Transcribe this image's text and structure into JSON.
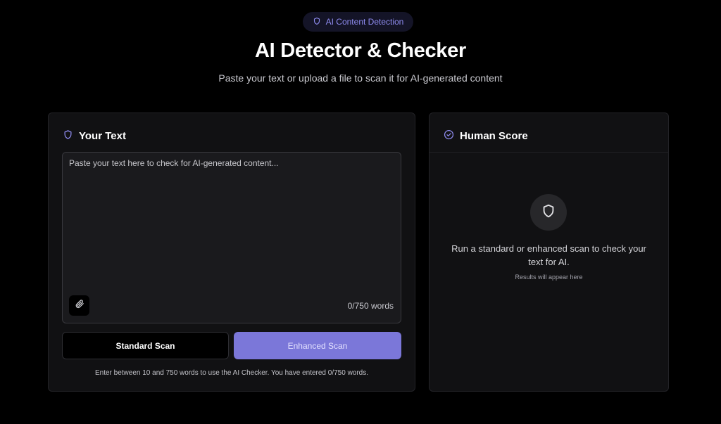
{
  "header": {
    "badge_label": "AI Content Detection",
    "badge_icon": "shield-icon",
    "title": "AI Detector & Checker",
    "subtitle": "Paste your text or upload a file to scan it for AI-generated content"
  },
  "input_panel": {
    "heading": "Your Text",
    "heading_icon": "shield-icon",
    "textarea": {
      "value": "",
      "placeholder": "Paste your text here to check for AI-generated content..."
    },
    "attach_icon": "paperclip-icon",
    "word_count": "0/750 words",
    "standard_button_label": "Standard Scan",
    "enhanced_button_label": "Enhanced Scan",
    "helper_text": "Enter between 10 and 750 words to use the AI Checker. You have entered 0/750 words."
  },
  "result_panel": {
    "heading": "Human Score",
    "heading_icon": "check-circle-icon",
    "empty_icon": "shield-icon",
    "empty_message": "Run a standard or enhanced scan to check your text for AI.",
    "empty_submessage": "Results will appear here"
  },
  "colors": {
    "background": "#000000",
    "card": "#111113",
    "accent": "#7b77d9",
    "badge_text": "#8f8cf0"
  }
}
